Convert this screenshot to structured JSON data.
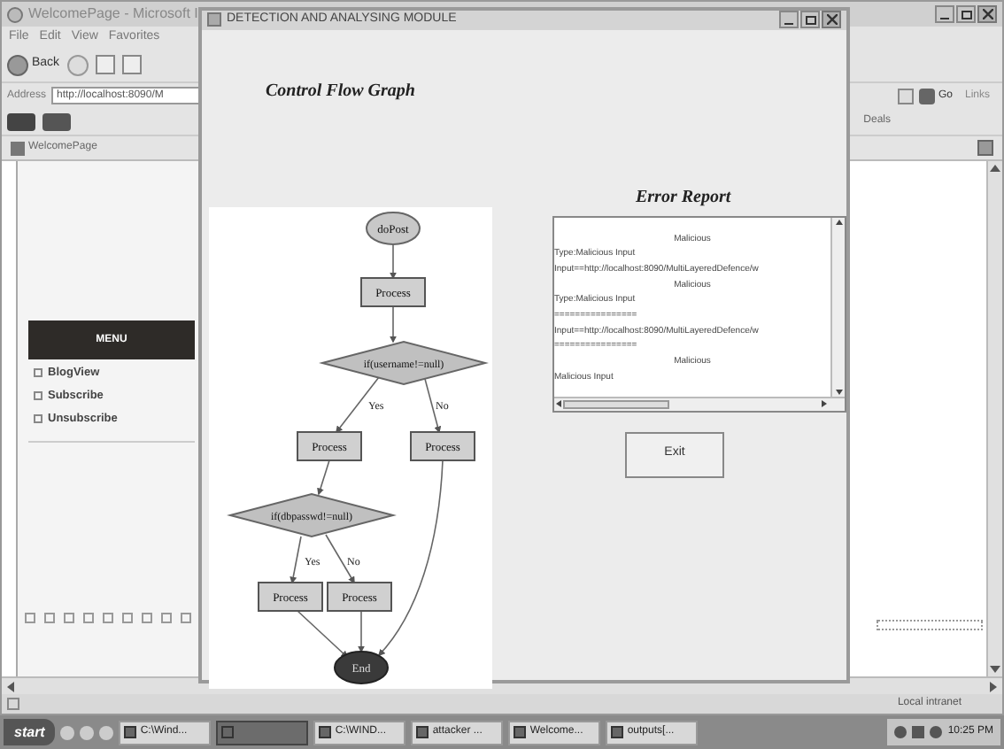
{
  "browser": {
    "title": "WelcomePage - Microsoft I",
    "menu": [
      "File",
      "Edit",
      "View",
      "Favorites"
    ],
    "back": "Back",
    "address_label": "Address",
    "address": "http://localhost:8090/M",
    "go": "Go",
    "links": "Links",
    "deals": "Deals",
    "tab": "WelcomePage",
    "sidebar": {
      "heading": "MENU",
      "items": [
        "BlogView",
        "Subscribe",
        "Unsubscribe"
      ]
    },
    "status": "Local intranet"
  },
  "dialog": {
    "title": "DETECTION AND ANALYSING MODULE",
    "graph_heading": "Control Flow Graph",
    "nodes": [
      {
        "kind": "start",
        "label": "doPost"
      },
      {
        "kind": "process",
        "label": "Process"
      },
      {
        "kind": "decision",
        "label": "if(username!=null)"
      },
      {
        "kind": "process",
        "label": "Process"
      },
      {
        "kind": "process",
        "label": "Process"
      },
      {
        "kind": "decision",
        "label": "if(dbpasswd!=null)"
      },
      {
        "kind": "process",
        "label": "Process"
      },
      {
        "kind": "process",
        "label": "Process"
      },
      {
        "kind": "end",
        "label": "End"
      }
    ],
    "edge_labels": [
      "Yes",
      "No",
      "Yes",
      "No"
    ],
    "report_heading": "Error Report",
    "report_lines": [
      {
        "text": "Malicious",
        "centered": true
      },
      {
        "text": "Type:Malicious Input",
        "centered": false
      },
      {
        "text": "Input==http://localhost:8090/MultiLayeredDefence/w",
        "centered": false
      },
      {
        "text": "Malicious",
        "centered": true
      },
      {
        "text": "Type:Malicious Input",
        "centered": false
      },
      {
        "text": "================",
        "centered": false
      },
      {
        "text": "Input==http://localhost:8090/MultiLayeredDefence/w",
        "centered": false
      },
      {
        "text": "================",
        "centered": false
      },
      {
        "text": "Malicious",
        "centered": true
      },
      {
        "text": "Malicious Input",
        "centered": false
      }
    ],
    "exit": "Exit"
  },
  "taskbar": {
    "start": "start",
    "tasks": [
      {
        "label": "C:\\Wind...",
        "selected": false
      },
      {
        "selected": true
      },
      {
        "label": "C:\\WIND...",
        "selected": false
      },
      {
        "label": "attacker ...",
        "selected": false
      },
      {
        "label": "Welcome...",
        "selected": false
      },
      {
        "label": "outputs[...",
        "selected": false
      }
    ],
    "clock": "10:25 PM"
  }
}
